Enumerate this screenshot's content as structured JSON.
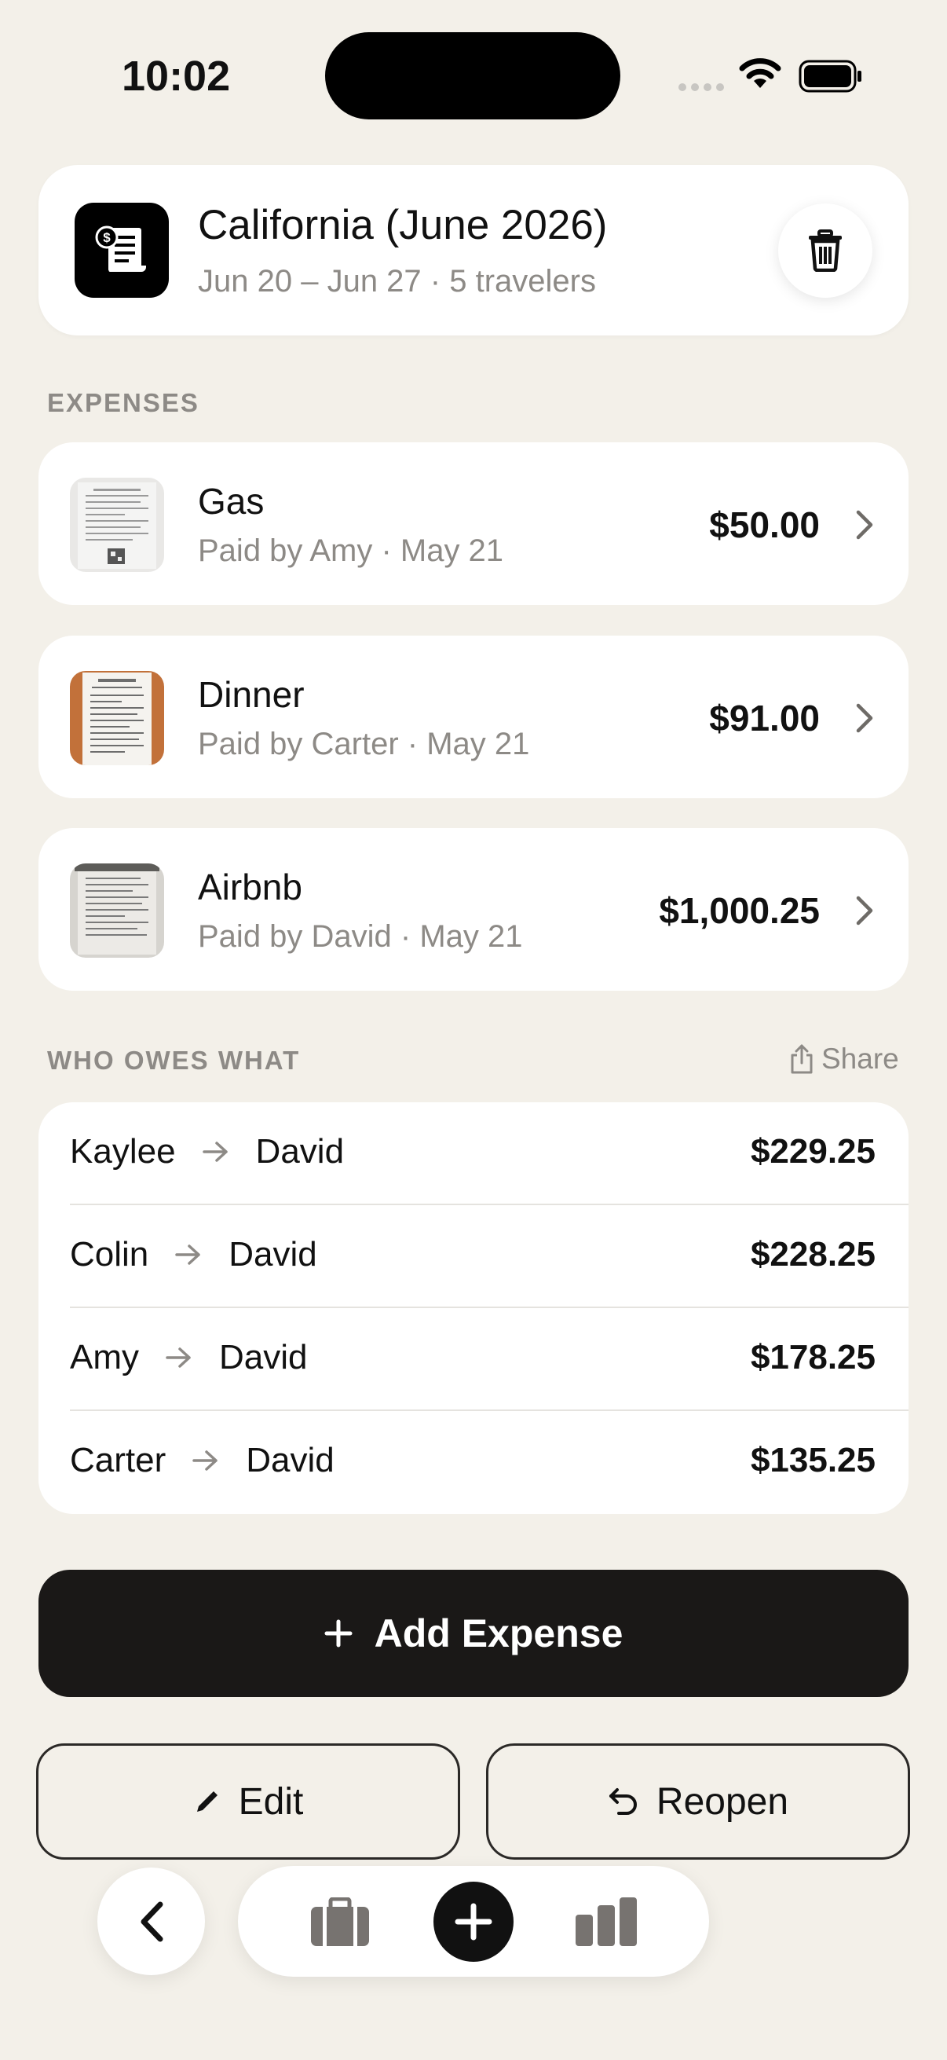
{
  "status": {
    "time": "10:02"
  },
  "trip": {
    "title": "California (June 2026)",
    "subtitle": "Jun 20 – Jun 27 · 5 travelers"
  },
  "expenses_section": {
    "label": "EXPENSES",
    "items": [
      {
        "name": "Gas",
        "subtitle": "Paid by Amy · May 21",
        "amount": "$50.00"
      },
      {
        "name": "Dinner",
        "subtitle": "Paid by Carter · May 21",
        "amount": "$91.00"
      },
      {
        "name": "Airbnb",
        "subtitle": "Paid by David · May 21",
        "amount": "$1,000.25"
      }
    ]
  },
  "owes_section": {
    "label": "WHO OWES WHAT",
    "share_label": "Share",
    "rows": [
      {
        "from": "Kaylee",
        "to": "David",
        "amount": "$229.25"
      },
      {
        "from": "Colin",
        "to": "David",
        "amount": "$228.25"
      },
      {
        "from": "Amy",
        "to": "David",
        "amount": "$178.25"
      },
      {
        "from": "Carter",
        "to": "David",
        "amount": "$135.25"
      }
    ]
  },
  "actions": {
    "add_expense": "Add Expense",
    "edit": "Edit",
    "reopen": "Reopen"
  },
  "nav": {
    "icons": [
      "back-icon",
      "suitcase-icon",
      "plus-icon",
      "chart-icon"
    ]
  },
  "colors": {
    "background": "#f3f0e9",
    "card": "#ffffff",
    "primary_dark": "#1a1817",
    "muted_text": "#8d8a86"
  }
}
